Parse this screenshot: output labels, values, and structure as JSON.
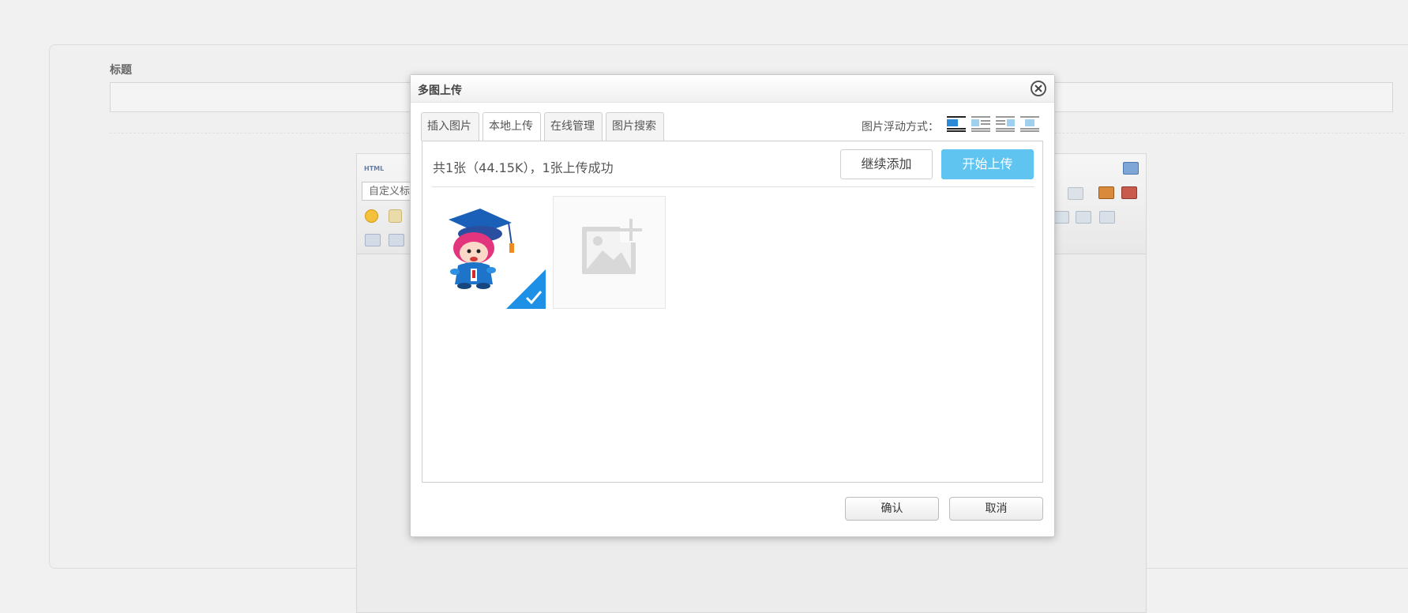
{
  "form": {
    "title_label": "标题"
  },
  "editor": {
    "html_button": "HTML",
    "font_select": "自定义标"
  },
  "dialog": {
    "title": "多图上传",
    "tabs": [
      {
        "label": "插入图片",
        "active": false
      },
      {
        "label": "本地上传",
        "active": true
      },
      {
        "label": "在线管理",
        "active": false
      },
      {
        "label": "图片搜索",
        "active": false
      }
    ],
    "float_label": "图片浮动方式：",
    "float_options": [
      "none-float-icon",
      "left-float-icon",
      "right-float-icon",
      "center-float-icon"
    ],
    "status": "共1张（44.15K），1张上传成功",
    "add_button": "继续添加",
    "start_button": "开始上传",
    "ok_button": "确认",
    "cancel_button": "取消"
  },
  "colors": {
    "accent": "#5fc4f0",
    "check_badge": "#1e90e6"
  }
}
